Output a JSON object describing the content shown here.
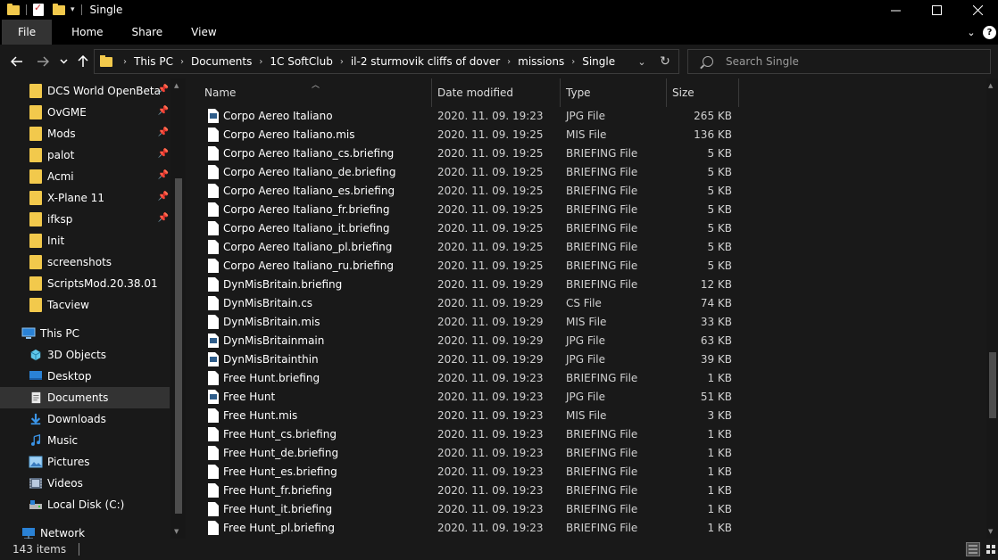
{
  "window": {
    "title": "Single"
  },
  "ribbon": {
    "tabs": [
      "File",
      "Home",
      "Share",
      "View"
    ]
  },
  "address": {
    "crumbs": [
      "This PC",
      "Documents",
      "1C SoftClub",
      "il-2 sturmovik cliffs of dover",
      "missions",
      "Single"
    ]
  },
  "search": {
    "placeholder": "Search Single"
  },
  "nav": {
    "quick_access": [
      {
        "label": "DCS World OpenBeta",
        "pinned": true
      },
      {
        "label": "OvGME",
        "pinned": true
      },
      {
        "label": "Mods",
        "pinned": true
      },
      {
        "label": "palot",
        "pinned": true
      },
      {
        "label": "Acmi",
        "pinned": true
      },
      {
        "label": "X-Plane 11",
        "pinned": true
      },
      {
        "label": "ifksp",
        "pinned": true
      },
      {
        "label": "Init",
        "pinned": false
      },
      {
        "label": "screenshots",
        "pinned": false
      },
      {
        "label": "ScriptsMod.20.38.01",
        "pinned": false
      },
      {
        "label": "Tacview",
        "pinned": false
      }
    ],
    "this_pc": "This PC",
    "pc_items": [
      {
        "label": "3D Objects",
        "icon": "cube-icon"
      },
      {
        "label": "Desktop",
        "icon": "desktop-icon"
      },
      {
        "label": "Documents",
        "icon": "documents-icon",
        "selected": true
      },
      {
        "label": "Downloads",
        "icon": "download-icon"
      },
      {
        "label": "Music",
        "icon": "music-icon"
      },
      {
        "label": "Pictures",
        "icon": "pictures-icon"
      },
      {
        "label": "Videos",
        "icon": "videos-icon"
      },
      {
        "label": "Local Disk (C:)",
        "icon": "disk-icon"
      }
    ],
    "network": "Network"
  },
  "columns": {
    "name": "Name",
    "date": "Date modified",
    "type": "Type",
    "size": "Size"
  },
  "files": [
    {
      "name": "Corpo Aereo Italiano",
      "date": "2020. 11. 09. 19:23",
      "type": "JPG File",
      "size": "265 KB",
      "kind": "jpg"
    },
    {
      "name": "Corpo Aereo Italiano.mis",
      "date": "2020. 11. 09. 19:25",
      "type": "MIS File",
      "size": "136 KB",
      "kind": "doc"
    },
    {
      "name": "Corpo Aereo Italiano_cs.briefing",
      "date": "2020. 11. 09. 19:25",
      "type": "BRIEFING File",
      "size": "5 KB",
      "kind": "doc"
    },
    {
      "name": "Corpo Aereo Italiano_de.briefing",
      "date": "2020. 11. 09. 19:25",
      "type": "BRIEFING File",
      "size": "5 KB",
      "kind": "doc"
    },
    {
      "name": "Corpo Aereo Italiano_es.briefing",
      "date": "2020. 11. 09. 19:25",
      "type": "BRIEFING File",
      "size": "5 KB",
      "kind": "doc"
    },
    {
      "name": "Corpo Aereo Italiano_fr.briefing",
      "date": "2020. 11. 09. 19:25",
      "type": "BRIEFING File",
      "size": "5 KB",
      "kind": "doc"
    },
    {
      "name": "Corpo Aereo Italiano_it.briefing",
      "date": "2020. 11. 09. 19:25",
      "type": "BRIEFING File",
      "size": "5 KB",
      "kind": "doc"
    },
    {
      "name": "Corpo Aereo Italiano_pl.briefing",
      "date": "2020. 11. 09. 19:25",
      "type": "BRIEFING File",
      "size": "5 KB",
      "kind": "doc"
    },
    {
      "name": "Corpo Aereo Italiano_ru.briefing",
      "date": "2020. 11. 09. 19:25",
      "type": "BRIEFING File",
      "size": "5 KB",
      "kind": "doc"
    },
    {
      "name": "DynMisBritain.briefing",
      "date": "2020. 11. 09. 19:29",
      "type": "BRIEFING File",
      "size": "12 KB",
      "kind": "doc"
    },
    {
      "name": "DynMisBritain.cs",
      "date": "2020. 11. 09. 19:29",
      "type": "CS File",
      "size": "74 KB",
      "kind": "doc"
    },
    {
      "name": "DynMisBritain.mis",
      "date": "2020. 11. 09. 19:29",
      "type": "MIS File",
      "size": "33 KB",
      "kind": "doc"
    },
    {
      "name": "DynMisBritainmain",
      "date": "2020. 11. 09. 19:29",
      "type": "JPG File",
      "size": "63 KB",
      "kind": "jpg"
    },
    {
      "name": "DynMisBritainthin",
      "date": "2020. 11. 09. 19:29",
      "type": "JPG File",
      "size": "39 KB",
      "kind": "jpg"
    },
    {
      "name": "Free Hunt.briefing",
      "date": "2020. 11. 09. 19:23",
      "type": "BRIEFING File",
      "size": "1 KB",
      "kind": "doc"
    },
    {
      "name": "Free Hunt",
      "date": "2020. 11. 09. 19:23",
      "type": "JPG File",
      "size": "51 KB",
      "kind": "jpg"
    },
    {
      "name": "Free Hunt.mis",
      "date": "2020. 11. 09. 19:23",
      "type": "MIS File",
      "size": "3 KB",
      "kind": "doc"
    },
    {
      "name": "Free Hunt_cs.briefing",
      "date": "2020. 11. 09. 19:23",
      "type": "BRIEFING File",
      "size": "1 KB",
      "kind": "doc"
    },
    {
      "name": "Free Hunt_de.briefing",
      "date": "2020. 11. 09. 19:23",
      "type": "BRIEFING File",
      "size": "1 KB",
      "kind": "doc"
    },
    {
      "name": "Free Hunt_es.briefing",
      "date": "2020. 11. 09. 19:23",
      "type": "BRIEFING File",
      "size": "1 KB",
      "kind": "doc"
    },
    {
      "name": "Free Hunt_fr.briefing",
      "date": "2020. 11. 09. 19:23",
      "type": "BRIEFING File",
      "size": "1 KB",
      "kind": "doc"
    },
    {
      "name": "Free Hunt_it.briefing",
      "date": "2020. 11. 09. 19:23",
      "type": "BRIEFING File",
      "size": "1 KB",
      "kind": "doc"
    },
    {
      "name": "Free Hunt_pl.briefing",
      "date": "2020. 11. 09. 19:23",
      "type": "BRIEFING File",
      "size": "1 KB",
      "kind": "doc"
    }
  ],
  "status": {
    "count": "143 items"
  },
  "colors": {
    "background": "#191919",
    "titlebar": "#000000",
    "selected": "#333333",
    "folder": "#f2c94c",
    "accent": "#0078d7"
  }
}
